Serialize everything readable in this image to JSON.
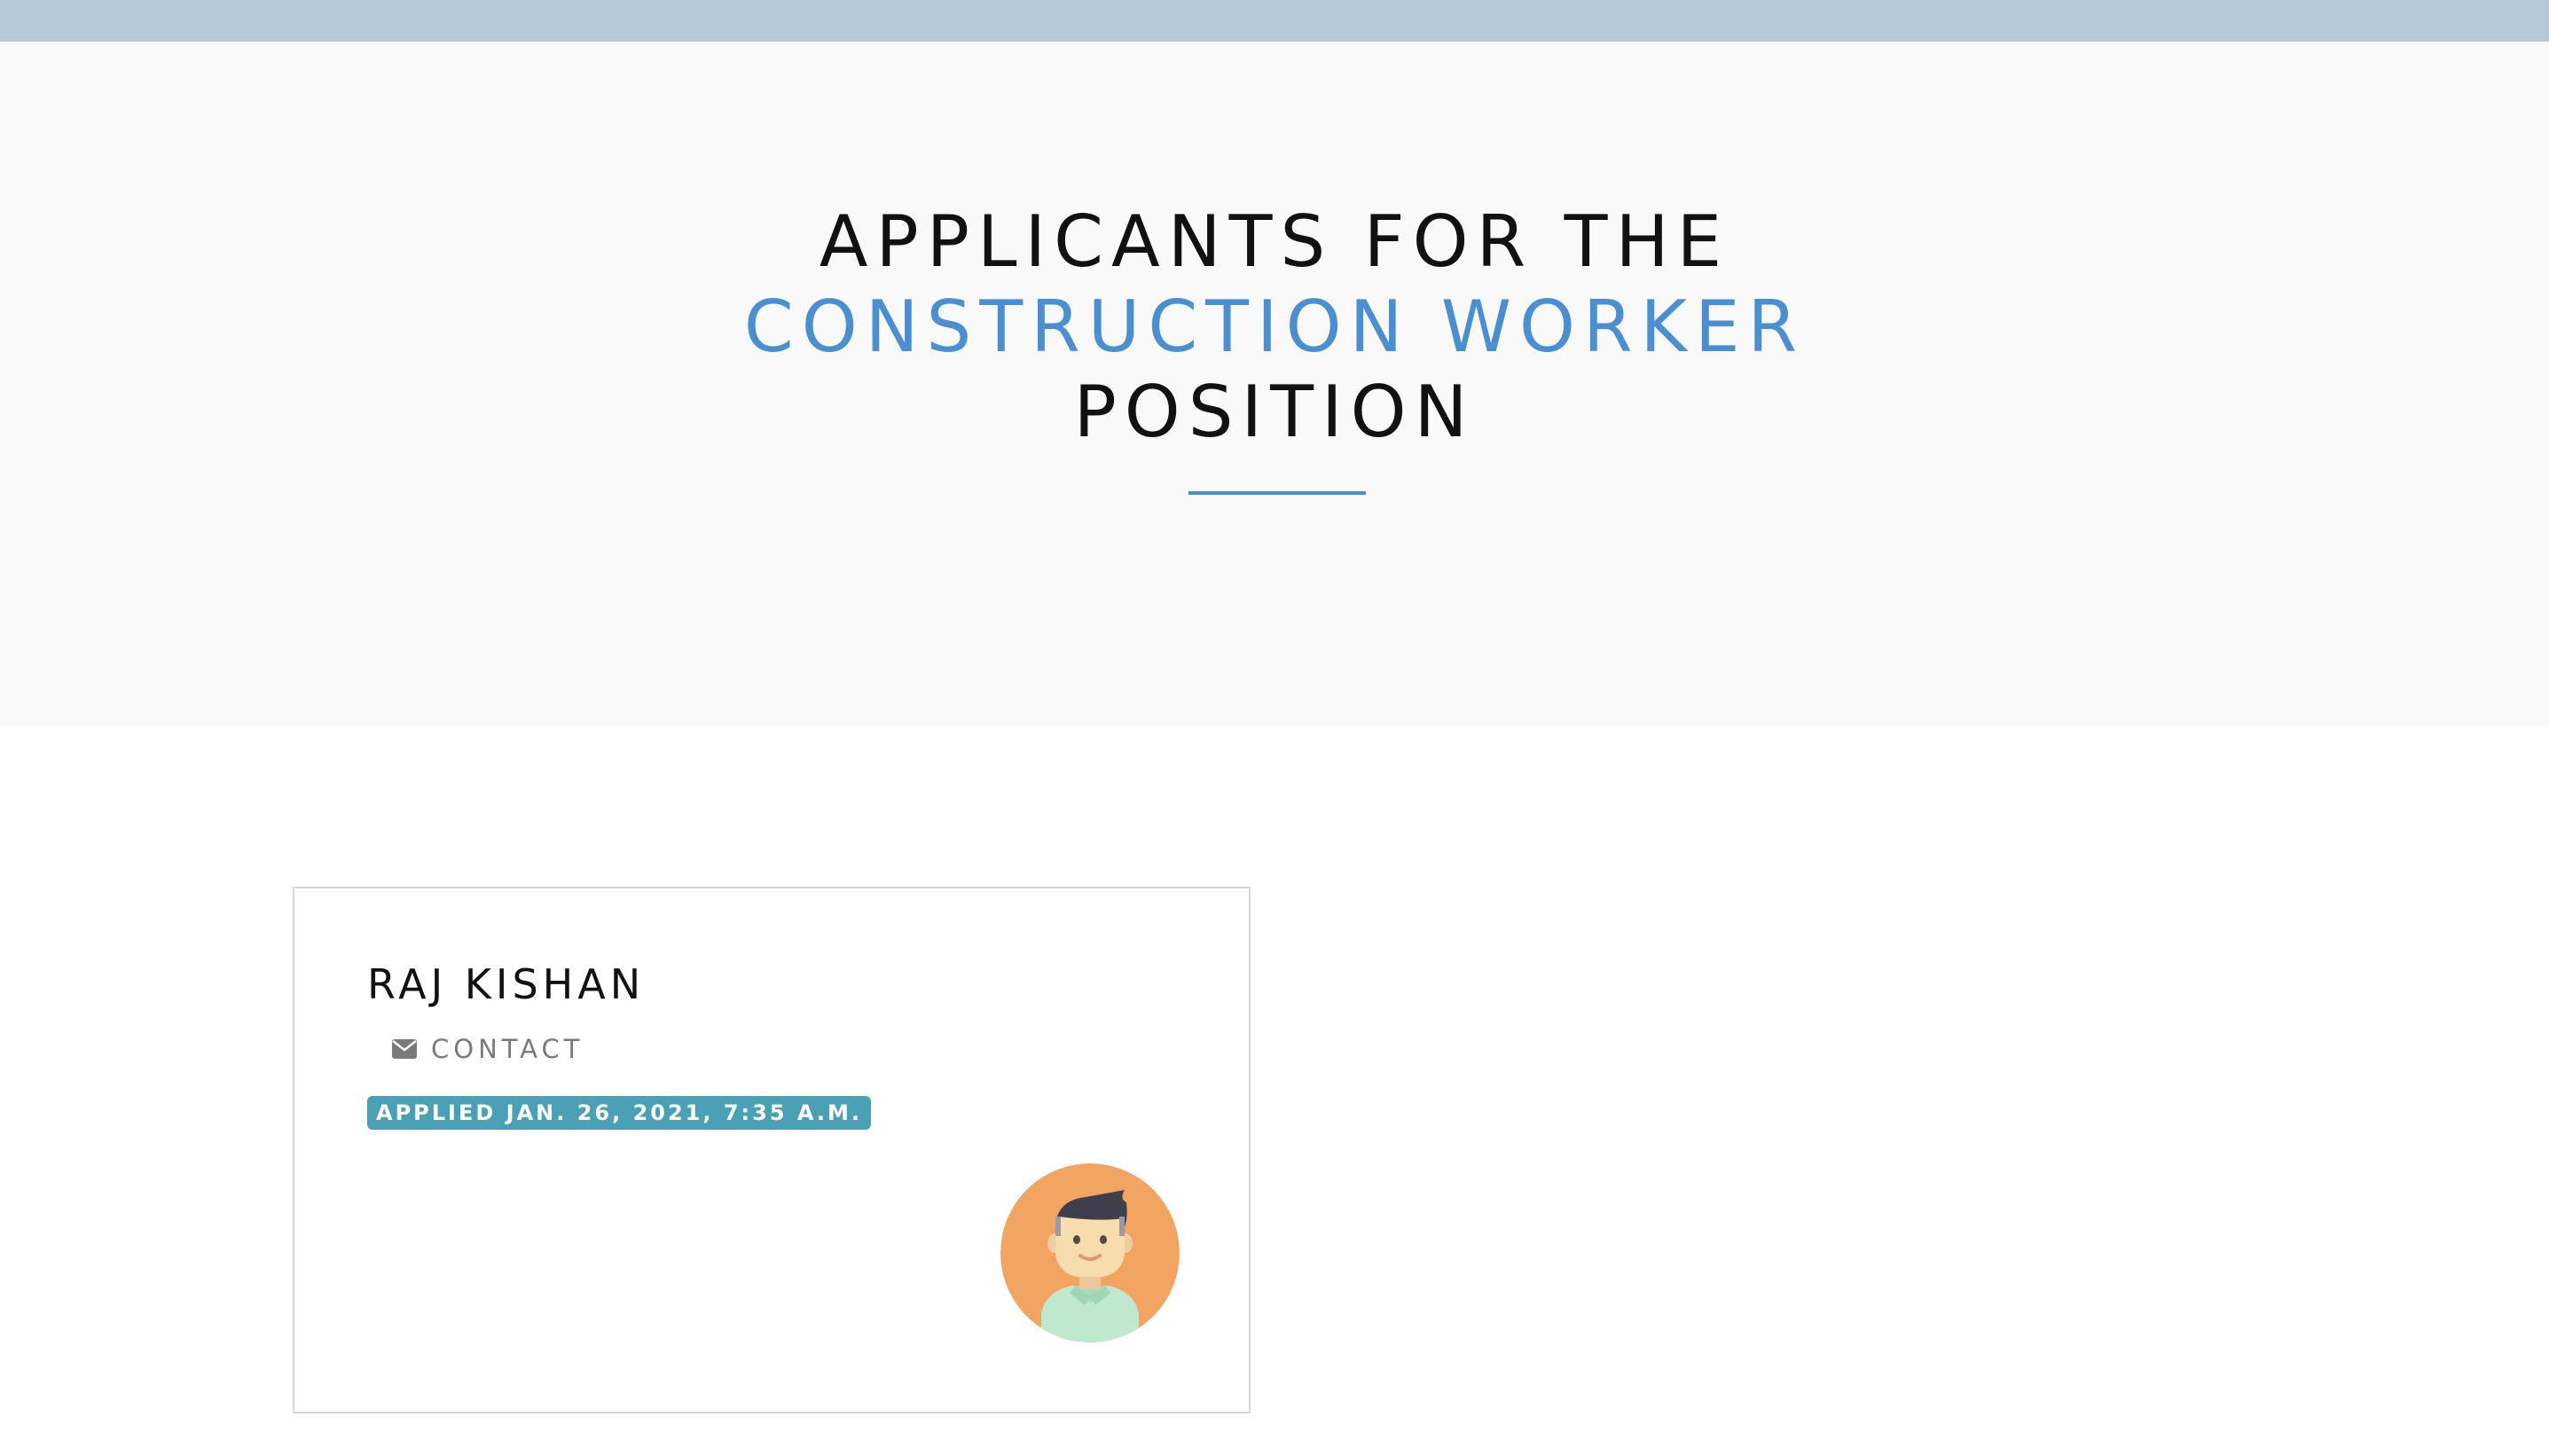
{
  "hero": {
    "line1": "APPLICANTS FOR THE",
    "line2": "CONSTRUCTION WORKER",
    "line3": "POSITION"
  },
  "applicants": [
    {
      "name": "RAJ KISHAN",
      "contact_label": "CONTACT",
      "contact_icon": "envelope-icon",
      "applied": "APPLIED JAN. 26, 2021, 7:35 A.M.",
      "avatar": "avatar"
    }
  ],
  "colors": {
    "topbar": "#b5c9d6",
    "hero_background": "#f9f9f9",
    "accent": "#4a8fd1",
    "badge": "#4aa0b5",
    "avatar_background": "#f2a563"
  }
}
